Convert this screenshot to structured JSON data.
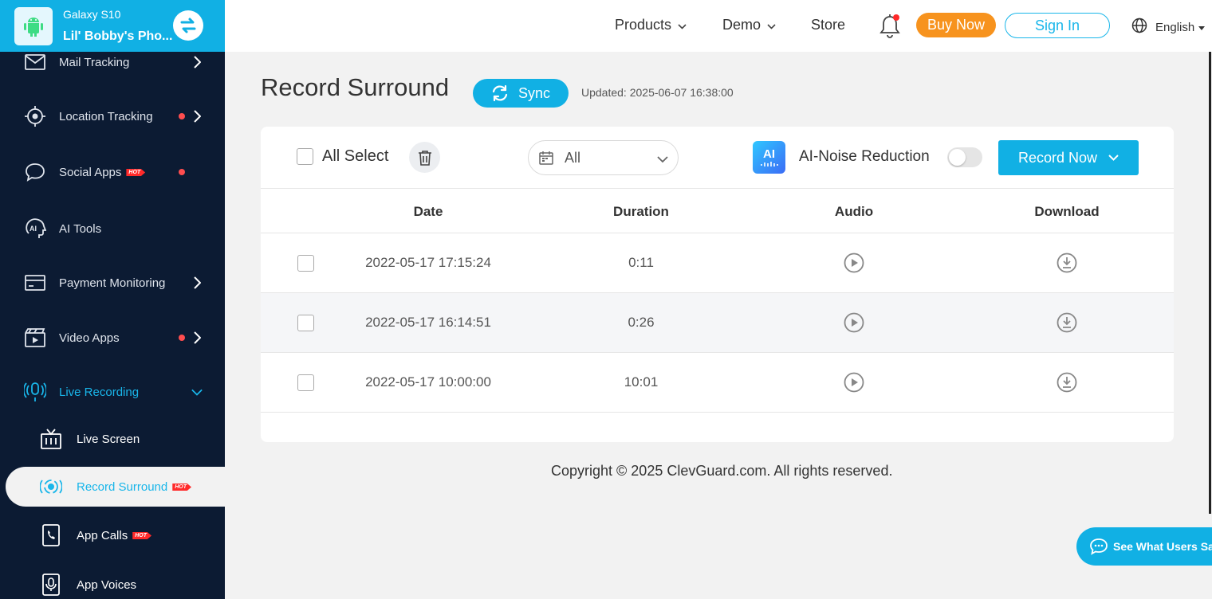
{
  "device": {
    "model": "Galaxy S10",
    "owner": "Lil' Bobby's Pho..."
  },
  "sidebar": {
    "items": [
      {
        "label": "Mail Tracking"
      },
      {
        "label": "Location Tracking"
      },
      {
        "label": "Social Apps",
        "badge": "HOT"
      },
      {
        "label": "AI Tools"
      },
      {
        "label": "Payment Monitoring"
      },
      {
        "label": "Video Apps"
      },
      {
        "label": "Live Recording"
      }
    ],
    "sub_items": [
      {
        "label": "Live Screen"
      },
      {
        "label": "Record Surround",
        "badge": "HOT"
      },
      {
        "label": "App Calls",
        "badge": "HOT"
      },
      {
        "label": "App Voices"
      }
    ]
  },
  "topbar": {
    "products": "Products",
    "demo": "Demo",
    "store": "Store",
    "buy_now": "Buy Now",
    "sign_in": "Sign In",
    "language": "English"
  },
  "main": {
    "title": "Record Surround",
    "sync_label": "Sync",
    "updated": "Updated: 2025-06-07 16:38:00",
    "toolbar": {
      "all_select": "All Select",
      "date_filter": "All",
      "ai_badge": "AI",
      "ai_label": "AI-Noise Reduction",
      "record_now": "Record Now"
    },
    "table": {
      "headers": [
        "Date",
        "Duration",
        "Audio",
        "Download"
      ],
      "rows": [
        {
          "date": "2022-05-17 17:15:24",
          "duration": "0:11"
        },
        {
          "date": "2022-05-17 16:14:51",
          "duration": "0:26"
        },
        {
          "date": "2022-05-17 10:00:00",
          "duration": "10:01"
        }
      ]
    }
  },
  "footer": {
    "copyright": "Copyright © 2025 ClevGuard.com. All rights reserved."
  },
  "floating": {
    "see_users": "See What Users Say"
  },
  "colors": {
    "accent": "#11b0e4",
    "sidebar_bg": "#0c1b33",
    "buy": "#f7931e",
    "alert": "#ff4d4f"
  }
}
